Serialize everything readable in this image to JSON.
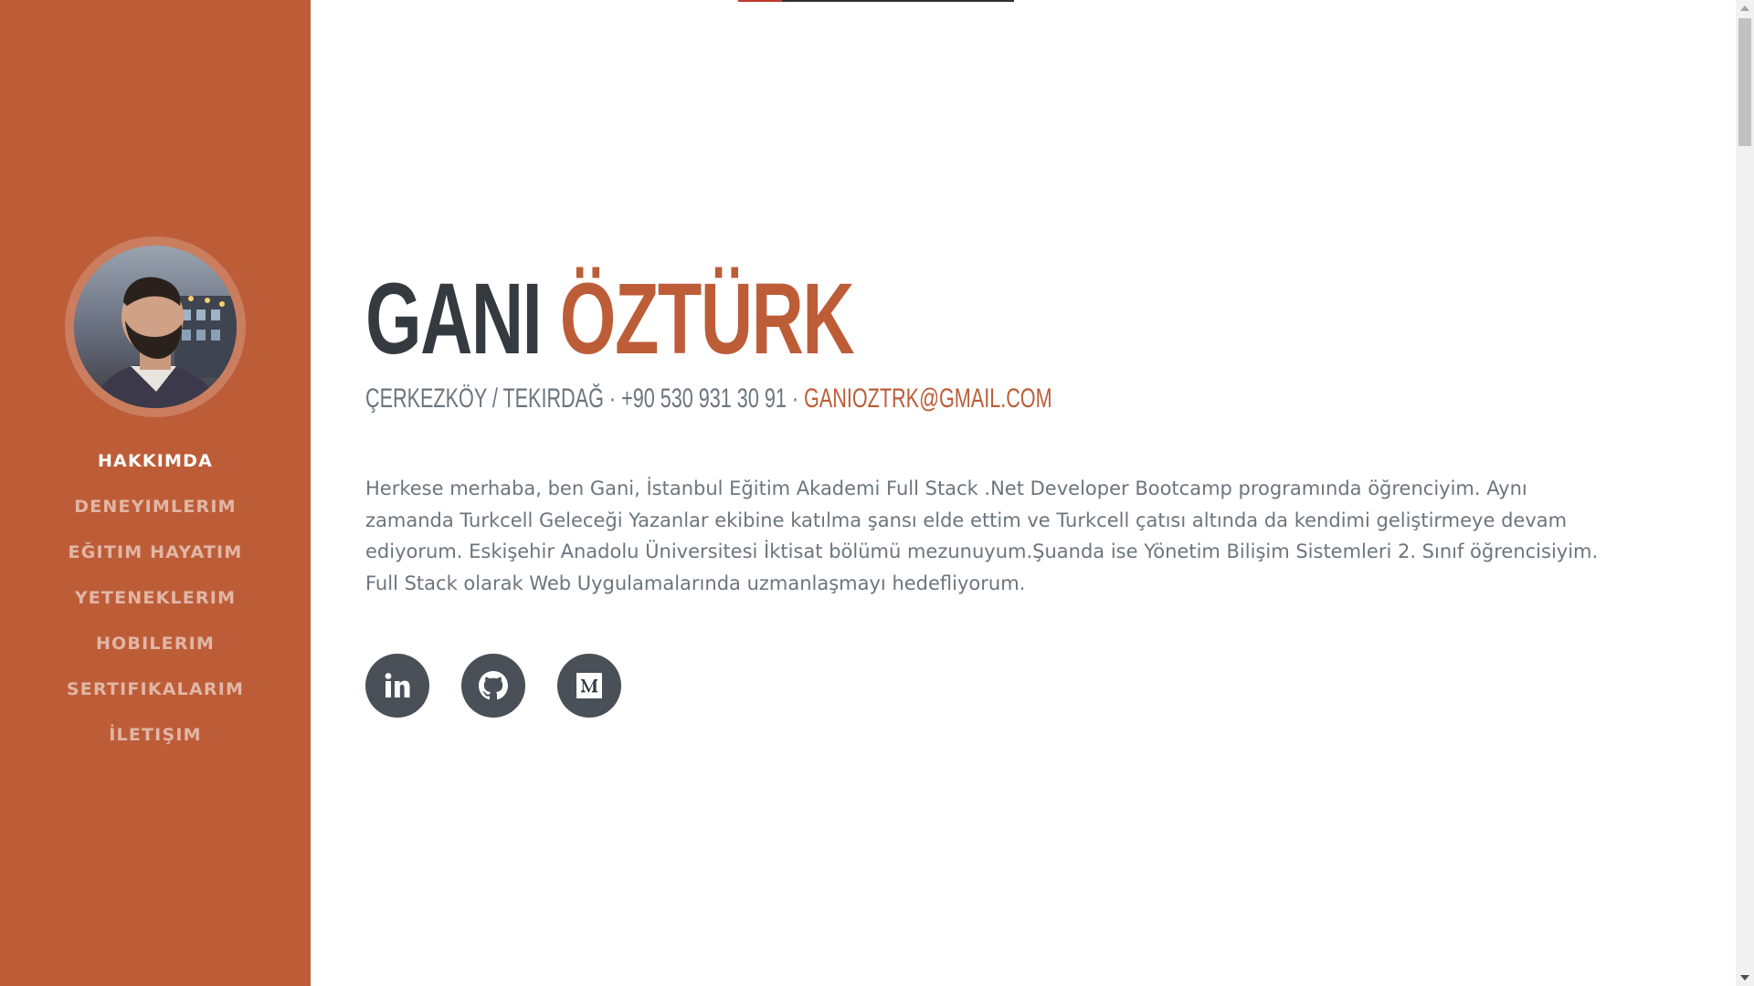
{
  "progress": {
    "fraction": 0.16
  },
  "sidebar": {
    "avatar_alt": "Profile photo",
    "items": [
      {
        "label": "HAKKIMDA",
        "active": true
      },
      {
        "label": "DENEYIMLERIM"
      },
      {
        "label": "EĞITIM HAYATIM"
      },
      {
        "label": "YETENEKLERIM"
      },
      {
        "label": "HOBILERIM"
      },
      {
        "label": "SERTIFIKALARIM"
      },
      {
        "label": "İLETIŞIM"
      }
    ]
  },
  "about": {
    "first_name": "GANI",
    "last_name": "ÖZTÜRK",
    "location": "ÇERKEZKÖY / TEKIRDAĞ",
    "separator": " · ",
    "phone": "+90 530 931 30 91",
    "email": "GANIOZTRK@GMAIL.COM",
    "bio": "Herkese merhaba, ben Gani, İstanbul Eğitim Akademi Full Stack .Net Developer Bootcamp programında öğrenciyim. Aynı zamanda Turkcell Geleceği Yazanlar ekibine katılma şansı elde ettim ve Turkcell çatısı altında da kendimi geliştirmeye devam ediyorum. Eskişehir Anadolu Üniversitesi İktisat bölümü mezunuyum.Şuanda ise Yönetim Bilişim Sistemleri 2. Sınıf öğrencisiyim. Full Stack olarak Web Uygulamalarında uzmanlaşmayı hedefliyorum."
  },
  "social": [
    {
      "icon": "linkedin-icon"
    },
    {
      "icon": "github-icon"
    },
    {
      "icon": "medium-icon"
    }
  ],
  "colors": {
    "primary": "#bd5d38",
    "dark": "#343a40",
    "muted": "#6c757d",
    "social_bg": "#495057"
  }
}
